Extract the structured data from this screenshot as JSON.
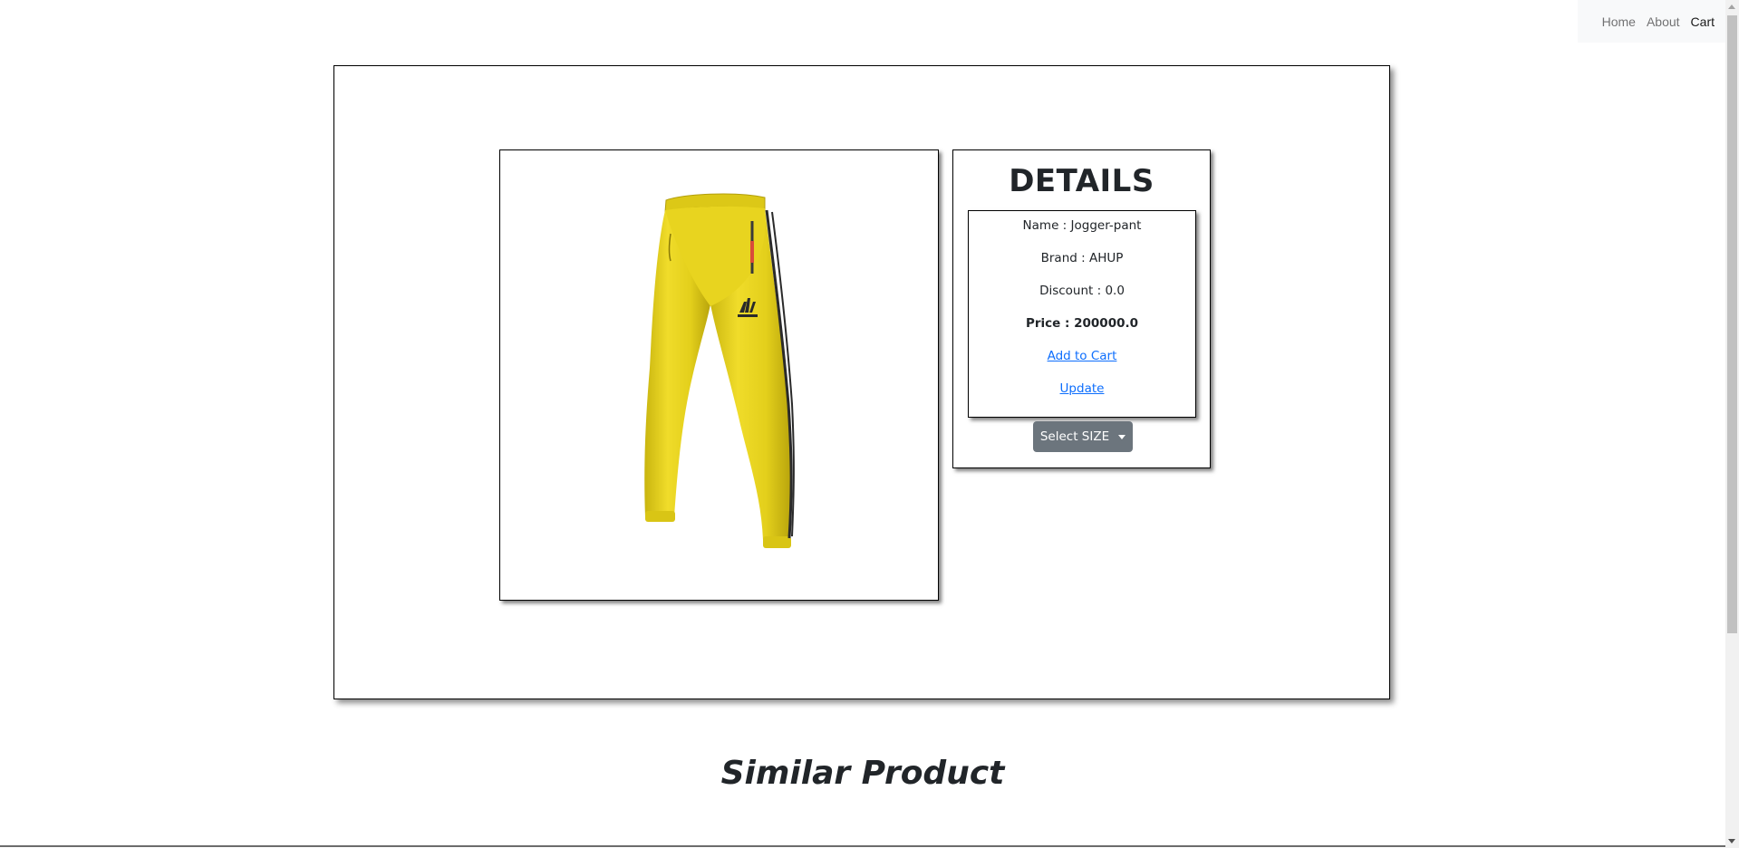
{
  "nav": {
    "items": [
      {
        "label": "Home"
      },
      {
        "label": "About"
      },
      {
        "label": "Cart"
      }
    ]
  },
  "product": {
    "image_alt": "Jogger-pant",
    "image_colors": {
      "fabric": "#e6d21c",
      "stripe": "#2a2a2a"
    },
    "details_title": "DETAILS",
    "name": "Name : Jogger-pant",
    "brand": "Brand : AHUP",
    "discount": "Discount : 0.0",
    "price": "Price : 200000.0",
    "add_to_cart": "Add to Cart",
    "update": "Update",
    "size_button": "Select SIZE"
  },
  "similar": {
    "heading": "Similar Product"
  }
}
